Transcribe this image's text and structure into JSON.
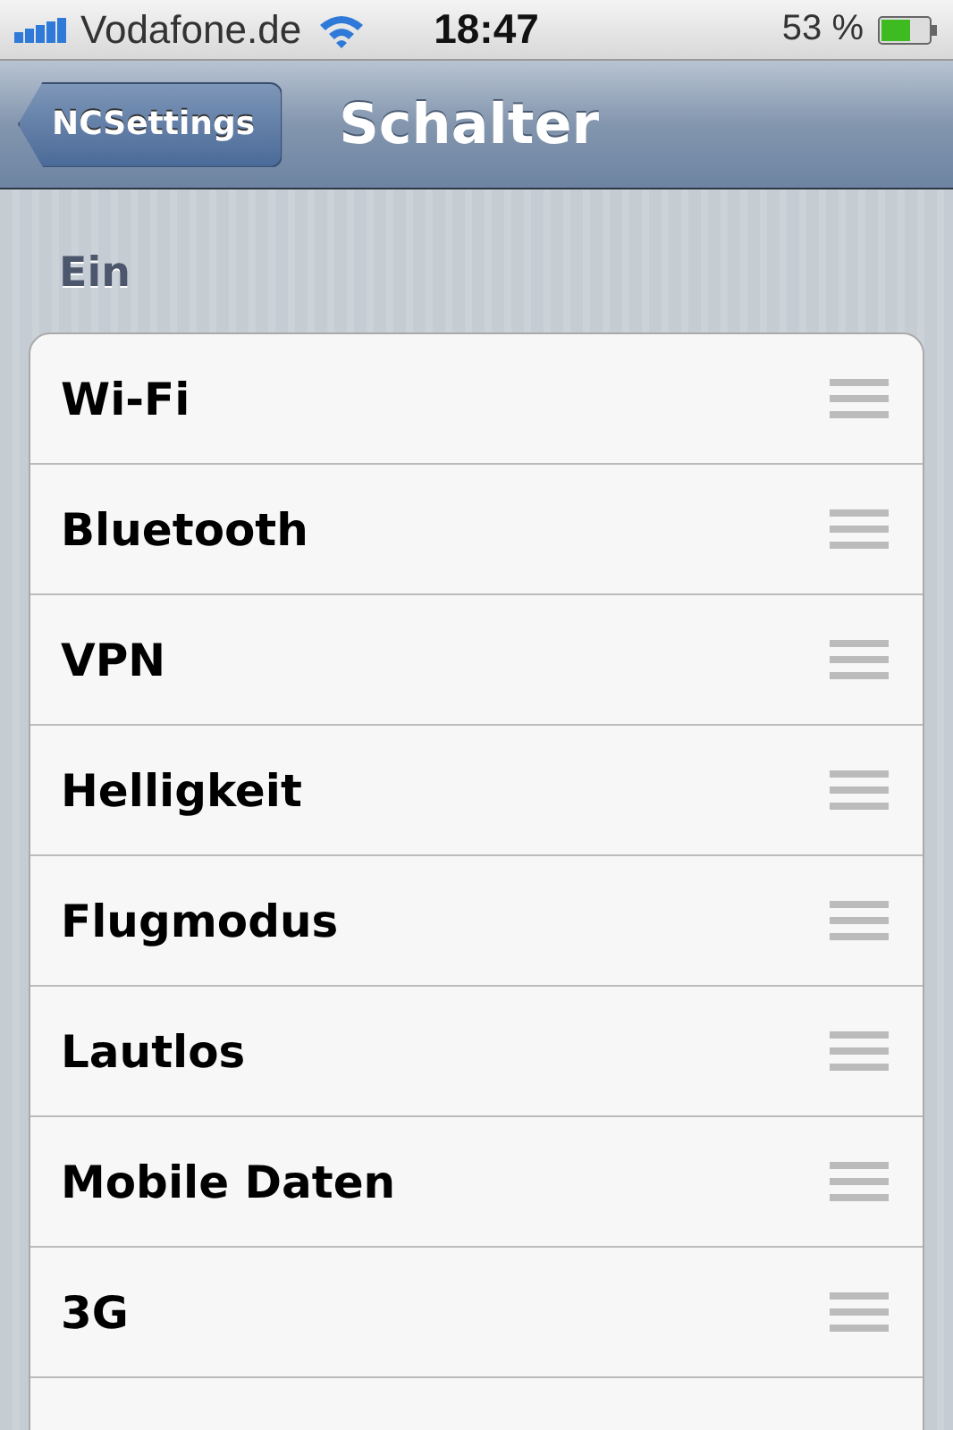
{
  "status_bar": {
    "carrier": "Vodafone.de",
    "time": "18:47",
    "battery": "53 %"
  },
  "nav_bar": {
    "back_button": "NCSettings",
    "title": "Schalter"
  },
  "section": {
    "header": "Ein",
    "rows": [
      {
        "label": "Wi-Fi"
      },
      {
        "label": "Bluetooth"
      },
      {
        "label": "VPN"
      },
      {
        "label": "Helligkeit"
      },
      {
        "label": "Flugmodus"
      },
      {
        "label": "Lautlos"
      },
      {
        "label": "Mobile Daten"
      },
      {
        "label": "3G"
      }
    ]
  }
}
